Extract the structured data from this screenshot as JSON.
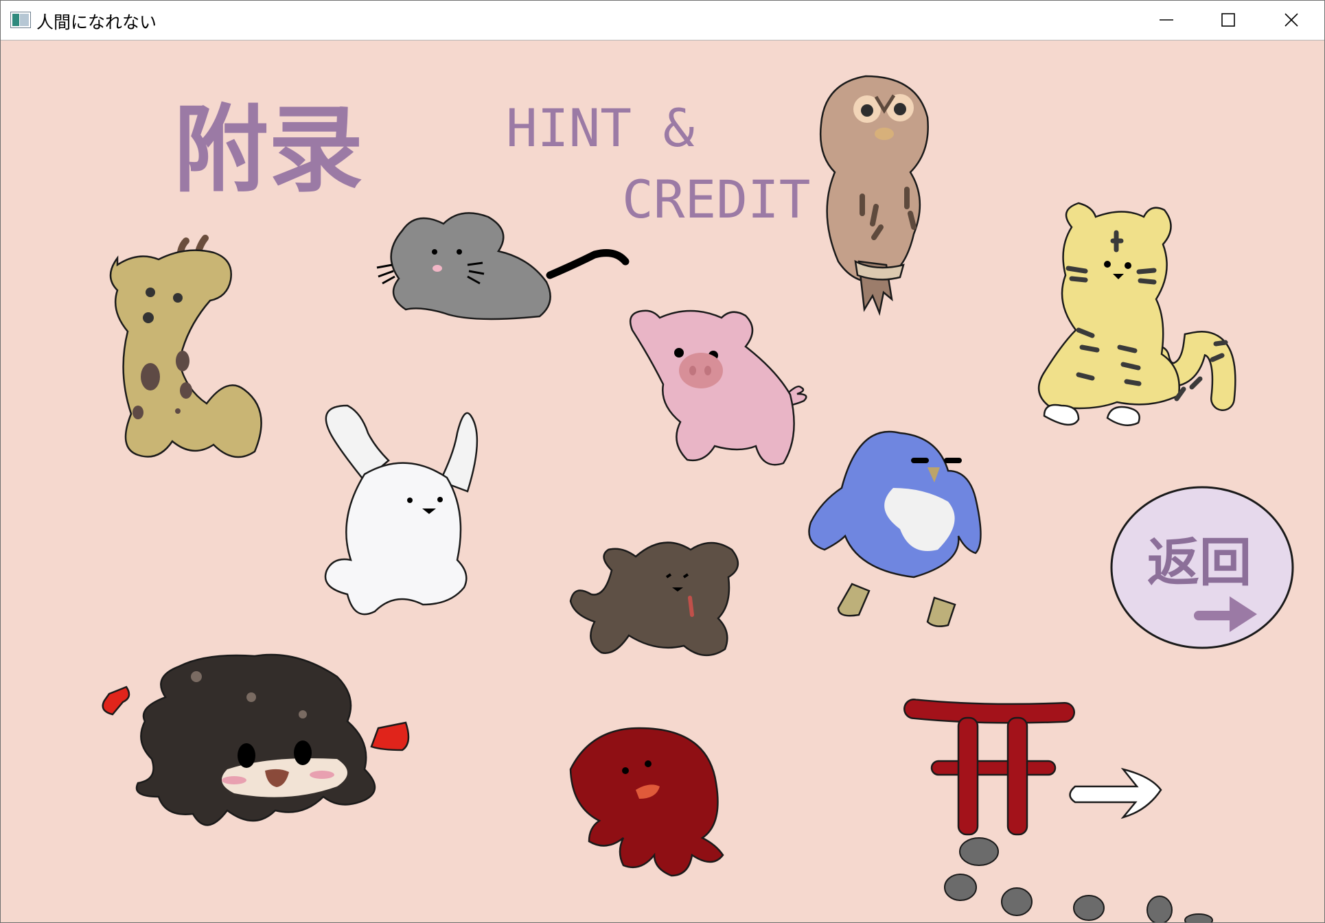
{
  "window": {
    "title": "人間になれない",
    "icon": "app-window-icon",
    "controls": [
      "minimize-icon",
      "maximize-icon",
      "close-icon"
    ]
  },
  "screen": {
    "title_cn": "附录",
    "subtitle_line1": "HINT &",
    "subtitle_line2": "CREDIT",
    "return_label": "返回"
  },
  "characters": [
    "giraffe",
    "mouse",
    "owl",
    "tiger",
    "pig",
    "rabbit",
    "penguin",
    "dog",
    "curly-haired-character",
    "red-octopus",
    "torii-gate"
  ],
  "colors": {
    "background": "#f5d8ce",
    "title_text": "#9b7aa5",
    "return_button": "#e6d9ec",
    "torii": "#a3121a"
  }
}
